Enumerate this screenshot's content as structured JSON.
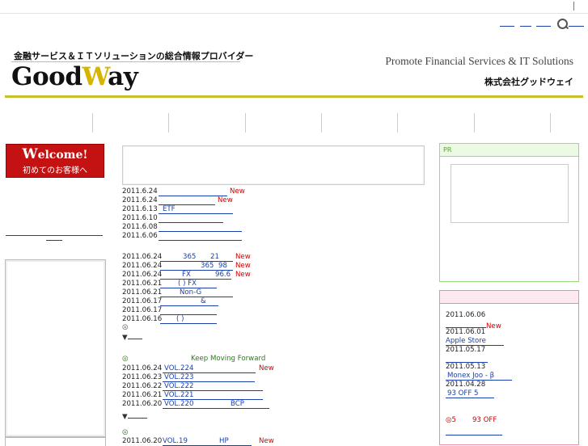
{
  "header": {
    "tagline": "金融サービス＆ＩＴソリューションの総合情報プロバイダー",
    "logo_good": "Good",
    "logo_w": "W",
    "logo_ay": "ay",
    "promote": "Promote Financial Services & IT Solutions",
    "company": "株式会社グッドウェイ",
    "search_icon": "search-icon"
  },
  "welcome": {
    "title_cap": "W",
    "title_rest": "elcome",
    "exclaim": "!",
    "subtitle": "初めてのお客様へ"
  },
  "news1": [
    {
      "date": "2011.6.24",
      "link": "",
      "new": "New"
    },
    {
      "date": "2011.6.24",
      "link": "",
      "new": "New"
    },
    {
      "date": "2011.6.13",
      "link": "ETF",
      "new": ""
    },
    {
      "date": "2011.6.10",
      "link": "",
      "new": ""
    },
    {
      "date": "2011.6.08",
      "link": "",
      "new": ""
    },
    {
      "date": "2011.6.06",
      "link": "",
      "new": ""
    }
  ],
  "news2": [
    {
      "date": "2011.06.24",
      "t1": "365",
      "t2": "21",
      "new": "New"
    },
    {
      "date": "2011.06.24",
      "t1": "365",
      "t2": "98",
      "new": "New"
    },
    {
      "date": "2011.06.24",
      "t1": "FX",
      "t2": "96.6",
      "new": "New"
    },
    {
      "date": "2011.06.21",
      "t1": "( ) FX",
      "t2": "",
      "new": ""
    },
    {
      "date": "2011.06.21",
      "t1": "Non-G",
      "t2": "",
      "new": ""
    },
    {
      "date": "2011.06.17",
      "t1": "&",
      "t2": "",
      "new": ""
    },
    {
      "date": "2011.06.17",
      "t1": "",
      "t2": "",
      "new": ""
    },
    {
      "date": "2011.06.16",
      "t1": "( )",
      "t2": "",
      "new": ""
    }
  ],
  "at_mark": "◎",
  "more_arrow": "▼",
  "section3": {
    "heading_mark": "◎",
    "heading": "Keep Moving Forward",
    "rows": [
      {
        "date": "2011.06.24",
        "link": "VOL.224",
        "extra": "",
        "new": "New"
      },
      {
        "date": "2011.06.23",
        "link": "VOL.223",
        "extra": "",
        "new": ""
      },
      {
        "date": "2011.06.22",
        "link": "VOL.222",
        "extra": "",
        "new": ""
      },
      {
        "date": "2011.06.21",
        "link": "VOL.221",
        "extra": "",
        "new": ""
      },
      {
        "date": "2011.06.20",
        "link": "VOL.220",
        "extra": "BCP",
        "new": ""
      }
    ]
  },
  "section4": {
    "mark": "◎",
    "date": "2011.06.20",
    "link": "VOL.19",
    "extra": "HP",
    "new": "New"
  },
  "pr": {
    "label": "PR"
  },
  "side2": {
    "items": [
      {
        "date": "2011.06.06",
        "link": "",
        "new": "New"
      },
      {
        "date": "2011.06.01",
        "link": "Apple Store",
        "new": ""
      },
      {
        "date": "2011.05.17",
        "link": "",
        "new": ""
      },
      {
        "date": "2011.05.13",
        "link": "Monex Joo - β",
        "new": ""
      },
      {
        "date": "2011.04.28",
        "link": "93 OFF 5",
        "new": ""
      }
    ],
    "promo_mark": "◎5",
    "promo_text": "93 OFF"
  }
}
